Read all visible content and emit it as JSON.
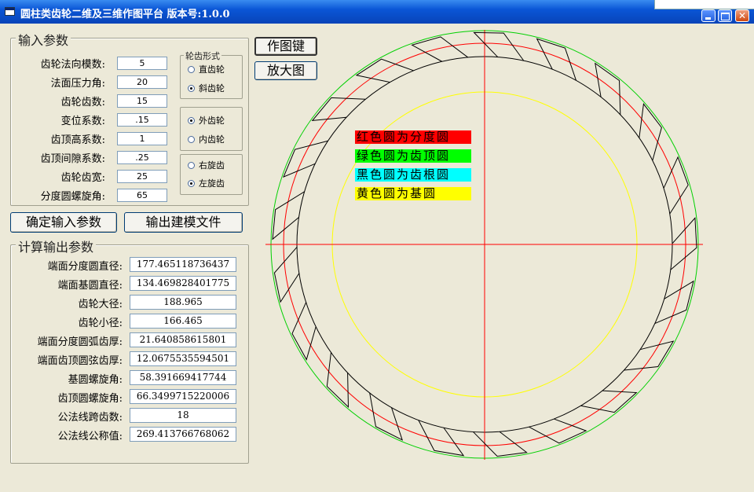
{
  "window": {
    "title": "圆柱类齿轮二维及三维作图平台 版本号:1.0.0"
  },
  "input_group": {
    "legend": "输入参数",
    "fields": [
      {
        "label": "齿轮法向模数:",
        "value": "5"
      },
      {
        "label": "法面压力角:",
        "value": "20"
      },
      {
        "label": "齿轮齿数:",
        "value": "15"
      },
      {
        "label": "变位系数:",
        "value": ".15"
      },
      {
        "label": "齿顶高系数:",
        "value": "1"
      },
      {
        "label": "齿顶间隙系数:",
        "value": ".25"
      },
      {
        "label": "齿轮齿宽:",
        "value": "25"
      },
      {
        "label": "分度圆螺旋角:",
        "value": "65"
      }
    ],
    "gear_form": {
      "legend": "轮齿形式",
      "options": [
        "直齿轮",
        "斜齿轮"
      ],
      "selected": "斜齿轮"
    },
    "gear_type": {
      "options": [
        "外齿轮",
        "内齿轮"
      ],
      "selected": "外齿轮"
    },
    "helix": {
      "options": [
        "右旋齿",
        "左旋齿"
      ],
      "selected": "左旋齿"
    }
  },
  "buttons": {
    "confirm": "确定输入参数",
    "export": "输出建模文件",
    "draw": "作图键",
    "zoom": "放大图"
  },
  "output_group": {
    "legend": "计算输出参数",
    "fields": [
      {
        "label": "端面分度圆直径:",
        "value": "177.465118736437"
      },
      {
        "label": "端面基圆直径:",
        "value": "134.469828401775"
      },
      {
        "label": "齿轮大径:",
        "value": "188.965"
      },
      {
        "label": "齿轮小径:",
        "value": "166.465"
      },
      {
        "label": "端面分度圆弧齿厚:",
        "value": "21.640858615801"
      },
      {
        "label": "端面齿顶圆弦齿厚:",
        "value": "12.0675535594501"
      },
      {
        "label": "基圆螺旋角:",
        "value": "58.391669417744"
      },
      {
        "label": "齿顶圆螺旋角:",
        "value": "66.3499715220006"
      },
      {
        "label": "公法线跨齿数:",
        "value": "18"
      },
      {
        "label": "公法线公称值:",
        "value": "269.413766768062"
      }
    ]
  },
  "legend_tags": [
    {
      "text": "红色圆为分度圆",
      "bg": "#ff0000",
      "fg": "#000000"
    },
    {
      "text": "绿色圆为齿顶圆",
      "bg": "#00ff00",
      "fg": "#000000"
    },
    {
      "text": "黑色圆为齿根圆",
      "bg": "#00ffff",
      "fg": "#000000"
    },
    {
      "text": "黄色圆为基圆",
      "bg": "#ffff00",
      "fg": "#000000"
    }
  ],
  "drawing": {
    "teeth": 21,
    "colors": {
      "pitch": "#ff0000",
      "tip": "#00d000",
      "root": "#000000",
      "base": "#ffff00",
      "axis": "#ff0000"
    }
  }
}
